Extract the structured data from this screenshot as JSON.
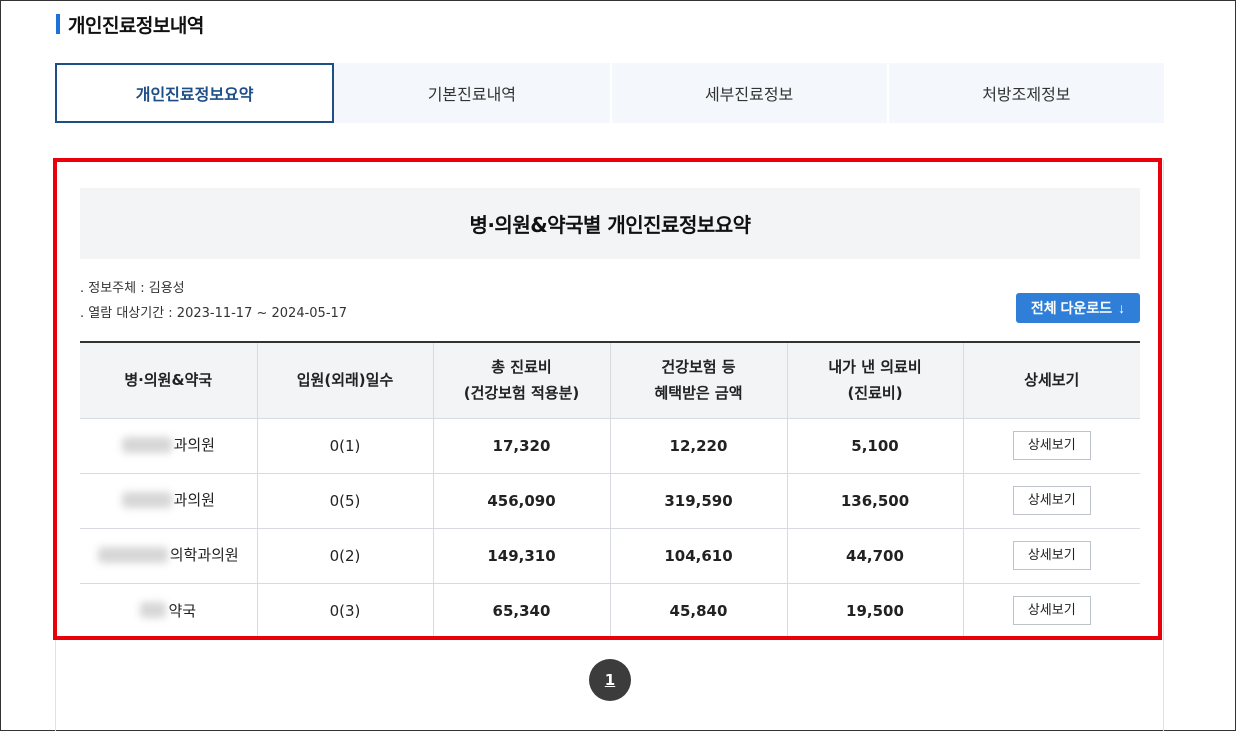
{
  "page_title": "개인진료정보내역",
  "tabs": [
    {
      "label": "개인진료정보요약",
      "active": true
    },
    {
      "label": "기본진료내역",
      "active": false
    },
    {
      "label": "세부진료정보",
      "active": false
    },
    {
      "label": "처방조제정보",
      "active": false
    }
  ],
  "summary": {
    "title": "병·의원&약국별 개인진료정보요약",
    "subject_label": ". 정보주체 : 김용성",
    "period_label": ". 열람 대상기간 : 2023-11-17 ~ 2024-05-17",
    "download_label": "전체 다운로드",
    "download_icon": "arrow-down-icon"
  },
  "table": {
    "headers": [
      [
        "병·의원&약국"
      ],
      [
        "입원(외래)일수"
      ],
      [
        "총 진료비",
        "(건강보험 적용분)"
      ],
      [
        "건강보험 등",
        "혜택받은 금액"
      ],
      [
        "내가 낸 의료비",
        "(진료비)"
      ],
      [
        "상세보기"
      ]
    ],
    "rows": [
      {
        "name": "과의원",
        "days": "0(1)",
        "total": "17,320",
        "benefit": "12,220",
        "paid": "5,100",
        "detail": "상세보기"
      },
      {
        "name": "과의원",
        "days": "0(5)",
        "total": "456,090",
        "benefit": "319,590",
        "paid": "136,500",
        "detail": "상세보기"
      },
      {
        "name": "의학과의원",
        "days": "0(2)",
        "total": "149,310",
        "benefit": "104,610",
        "paid": "44,700",
        "detail": "상세보기"
      },
      {
        "name": "약국",
        "days": "0(3)",
        "total": "65,340",
        "benefit": "45,840",
        "paid": "19,500",
        "detail": "상세보기"
      }
    ]
  },
  "pagination": {
    "current": "1"
  },
  "colors": {
    "accent": "#1d4f86",
    "download": "#2f7fd8",
    "highlight": "#e8000b"
  }
}
